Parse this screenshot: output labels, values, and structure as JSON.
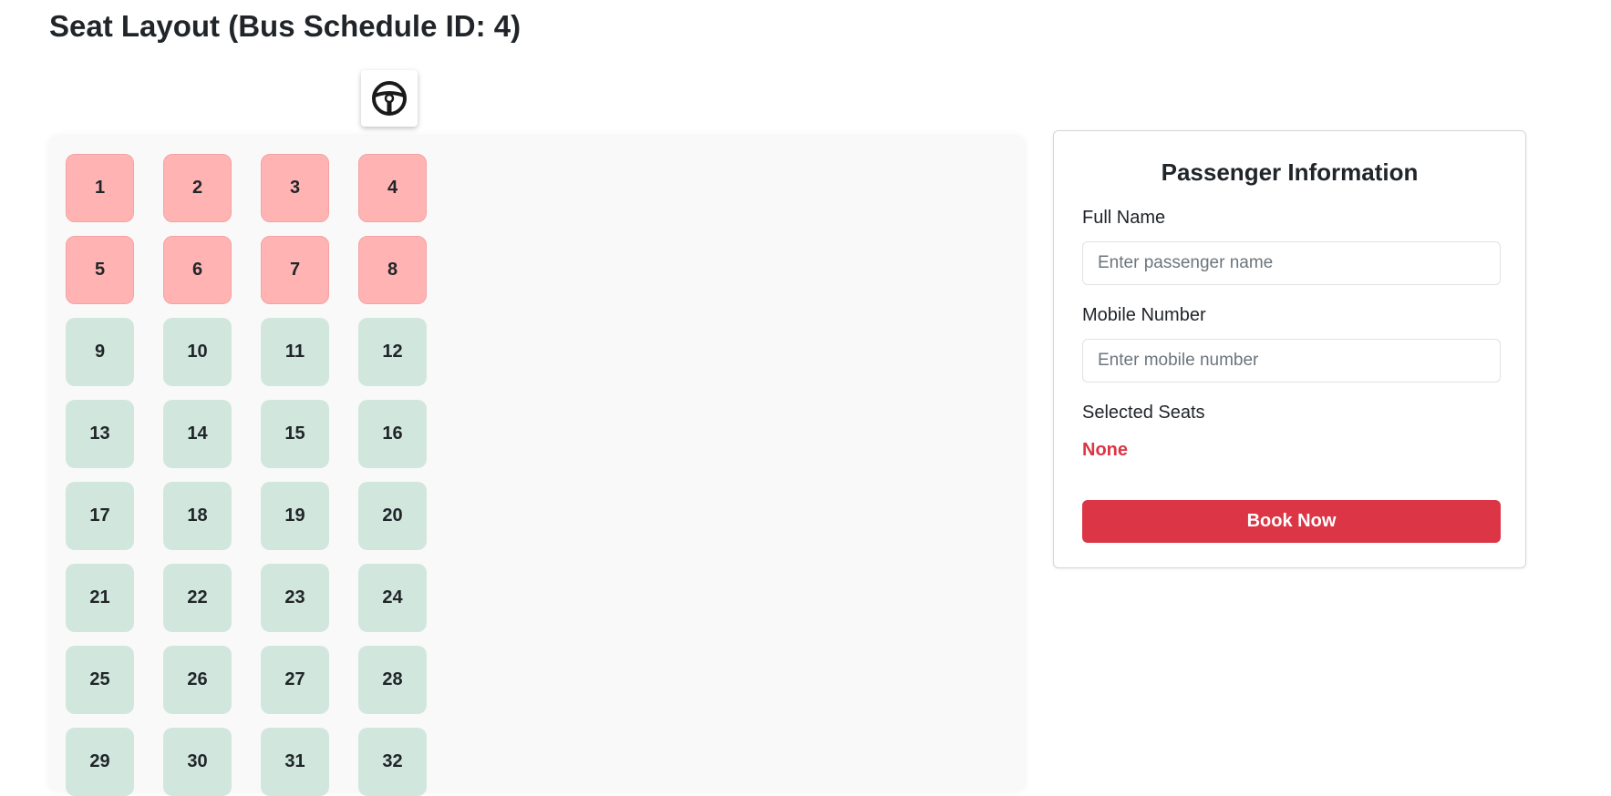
{
  "page": {
    "title": "Seat Layout (Bus Schedule ID: 4)"
  },
  "driver": {
    "icon": "steering-wheel-icon"
  },
  "seats": [
    {
      "number": "1",
      "status": "booked"
    },
    {
      "number": "2",
      "status": "booked"
    },
    {
      "number": "3",
      "status": "booked"
    },
    {
      "number": "4",
      "status": "booked"
    },
    {
      "number": "5",
      "status": "booked"
    },
    {
      "number": "6",
      "status": "booked"
    },
    {
      "number": "7",
      "status": "booked"
    },
    {
      "number": "8",
      "status": "booked"
    },
    {
      "number": "9",
      "status": "available"
    },
    {
      "number": "10",
      "status": "available"
    },
    {
      "number": "11",
      "status": "available"
    },
    {
      "number": "12",
      "status": "available"
    },
    {
      "number": "13",
      "status": "available"
    },
    {
      "number": "14",
      "status": "available"
    },
    {
      "number": "15",
      "status": "available"
    },
    {
      "number": "16",
      "status": "available"
    },
    {
      "number": "17",
      "status": "available"
    },
    {
      "number": "18",
      "status": "available"
    },
    {
      "number": "19",
      "status": "available"
    },
    {
      "number": "20",
      "status": "available"
    },
    {
      "number": "21",
      "status": "available"
    },
    {
      "number": "22",
      "status": "available"
    },
    {
      "number": "23",
      "status": "available"
    },
    {
      "number": "24",
      "status": "available"
    },
    {
      "number": "25",
      "status": "available"
    },
    {
      "number": "26",
      "status": "available"
    },
    {
      "number": "27",
      "status": "available"
    },
    {
      "number": "28",
      "status": "available"
    },
    {
      "number": "29",
      "status": "available"
    },
    {
      "number": "30",
      "status": "available"
    },
    {
      "number": "31",
      "status": "available"
    },
    {
      "number": "32",
      "status": "available"
    }
  ],
  "colors": {
    "booked": "#ffb3b3",
    "available": "#d1e7dd",
    "accent": "#dc3545"
  },
  "passenger_form": {
    "title": "Passenger Information",
    "full_name_label": "Full Name",
    "full_name_placeholder": "Enter passenger name",
    "full_name_value": "",
    "mobile_label": "Mobile Number",
    "mobile_placeholder": "Enter mobile number",
    "mobile_value": "",
    "selected_seats_label": "Selected Seats",
    "selected_seats_value": "None",
    "book_button": "Book Now"
  }
}
